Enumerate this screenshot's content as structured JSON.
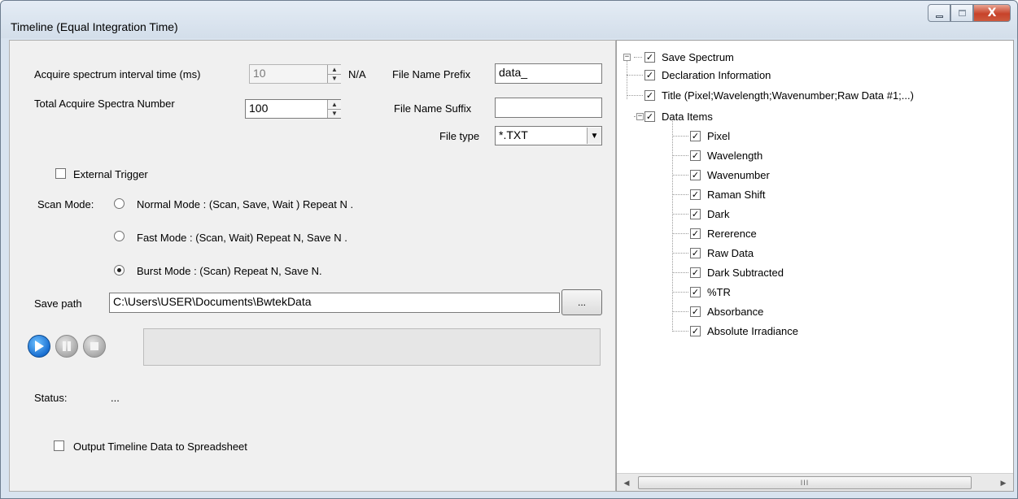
{
  "window": {
    "title": "Timeline (Equal Integration Time)",
    "close_glyph": "X"
  },
  "acquire": {
    "interval_label": "Acquire spectrum interval time (ms)",
    "interval_value": "10",
    "interval_unit": "N/A",
    "total_label": "Total Acquire Spectra Number",
    "total_value": "100"
  },
  "file": {
    "prefix_label": "File Name Prefix",
    "prefix_value": "data_",
    "suffix_label": "File Name Suffix",
    "suffix_value": "",
    "type_label": "File type",
    "type_value": "*.TXT"
  },
  "external_trigger": {
    "label": "External Trigger",
    "checked": false
  },
  "scan_mode": {
    "label": "Scan Mode:",
    "options": [
      {
        "label": "Normal Mode : (Scan, Save, Wait ) Repeat N .",
        "checked": false
      },
      {
        "label": "Fast Mode : (Scan, Wait) Repeat N, Save N .",
        "checked": false
      },
      {
        "label": "Burst Mode : (Scan) Repeat N, Save N.",
        "checked": true
      }
    ]
  },
  "save_path": {
    "label": "Save path",
    "value": "C:\\Users\\USER\\Documents\\BwtekData",
    "browse_label": "..."
  },
  "status": {
    "label": "Status:",
    "value": "..."
  },
  "output_spreadsheet": {
    "label": "Output Timeline Data to Spreadsheet",
    "checked": false
  },
  "tree": {
    "root": {
      "label": "Save Spectrum",
      "checked": true
    },
    "declaration": {
      "label": "Declaration Information",
      "checked": true
    },
    "title_item": {
      "label": "Title   (Pixel;Wavelength;Wavenumber;Raw Data #1;...)",
      "checked": true
    },
    "data_items": {
      "label": "Data Items",
      "checked": true
    },
    "items": [
      {
        "label": "Pixel",
        "checked": true
      },
      {
        "label": "Wavelength",
        "checked": true
      },
      {
        "label": "Wavenumber",
        "checked": true
      },
      {
        "label": "Raman Shift",
        "checked": true
      },
      {
        "label": "Dark",
        "checked": true
      },
      {
        "label": "Rererence",
        "checked": true
      },
      {
        "label": "Raw Data",
        "checked": true
      },
      {
        "label": "Dark Subtracted",
        "checked": true
      },
      {
        "label": "%TR",
        "checked": true
      },
      {
        "label": "Absorbance",
        "checked": true
      },
      {
        "label": "Absolute Irradiance",
        "checked": true
      }
    ]
  },
  "check_glyph": "✓",
  "scrollbar": {
    "thumb_grip": "III"
  }
}
